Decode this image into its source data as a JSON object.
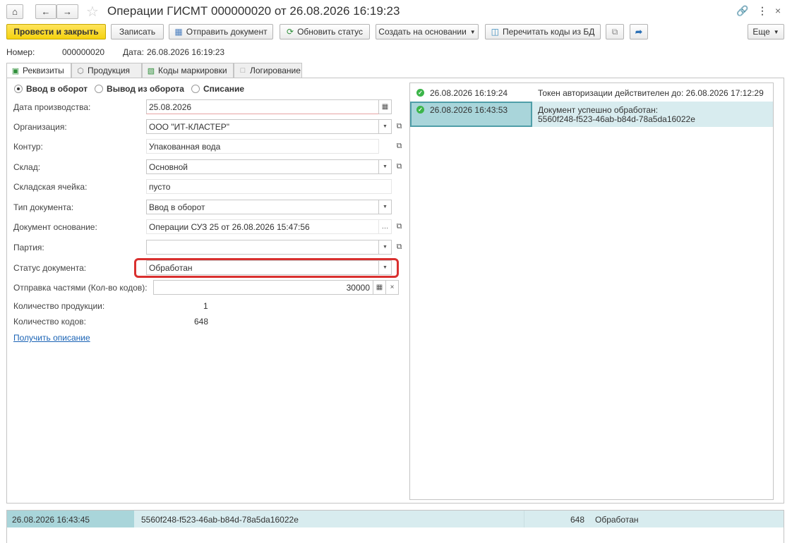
{
  "window": {
    "title": "Операции ГИСМТ 000000020 от 26.08.2026 16:19:23",
    "home_icon": "home-icon",
    "back_icon": "arrow-left-icon",
    "forward_icon": "arrow-right-icon",
    "link_icon": "link-icon",
    "more_icon": "more-vertical-icon",
    "close_icon": "close-icon"
  },
  "toolbar": {
    "post_close": "Провести и закрыть",
    "write": "Записать",
    "send_doc": "Отправить документ",
    "update_status": "Обновить статус",
    "create_based": "Создать на основании",
    "reread_codes": "Перечитать коды из БД",
    "more": "Еще"
  },
  "header": {
    "number_label": "Номер:",
    "number_value": "000000020",
    "date_label": "Дата:",
    "date_value": "26.08.2026 16:19:23"
  },
  "tabs": [
    {
      "label": "Реквизиты",
      "active": true
    },
    {
      "label": "Продукция",
      "active": false
    },
    {
      "label": "Коды маркировки",
      "active": false
    },
    {
      "label": "Логирование",
      "active": false
    }
  ],
  "radio": {
    "opt1": "Ввод в оборот",
    "opt2": "Вывод из оборота",
    "opt3": "Списание",
    "selected": "Ввод в оборот"
  },
  "fields": {
    "production_date": {
      "label": "Дата производства:",
      "value": "25.08.2026"
    },
    "organization": {
      "label": "Организация:",
      "value": "ООО \"ИТ-КЛАСТЕР\""
    },
    "contour": {
      "label": "Контур:",
      "value": "Упакованная вода"
    },
    "warehouse": {
      "label": "Склад:",
      "value": "Основной"
    },
    "cell": {
      "label": "Складская ячейка:",
      "value": "пусто"
    },
    "doc_type": {
      "label": "Тип документа:",
      "value": "Ввод в оборот"
    },
    "base_doc": {
      "label": "Документ основание:",
      "value": "Операции СУЗ 25 от 26.08.2026 15:47:56"
    },
    "batch": {
      "label": "Партия:",
      "value": ""
    },
    "status": {
      "label": "Статус документа:",
      "value": "Обработан"
    },
    "parts": {
      "label": "Отправка частями (Кол-во кодов):",
      "value": "30000"
    }
  },
  "stats": {
    "products_label": "Количество продукции:",
    "products_value": "1",
    "codes_label": "Количество кодов:",
    "codes_value": "648",
    "get_desc_link": "Получить описание"
  },
  "log": [
    {
      "time": "26.08.2026 16:19:24",
      "message": "Токен авторизации действителен до: 26.08.2026 17:12:29"
    },
    {
      "time": "26.08.2026 16:43:53",
      "message_line1": "Документ успешно обработан:",
      "message_line2": "5560f248-f523-46ab-b84d-78a5da16022e"
    }
  ],
  "bottom_row": {
    "time": "26.08.2026 16:43:45",
    "id": "5560f248-f523-46ab-b84d-78a5da16022e",
    "count": "648",
    "status": "Обработан"
  },
  "colors": {
    "primary_button": "#f5d20f",
    "selection": "#a9d5da",
    "status_highlight": "#d9302f",
    "ok_icon": "#3cb54a",
    "link": "#1a63b5"
  }
}
